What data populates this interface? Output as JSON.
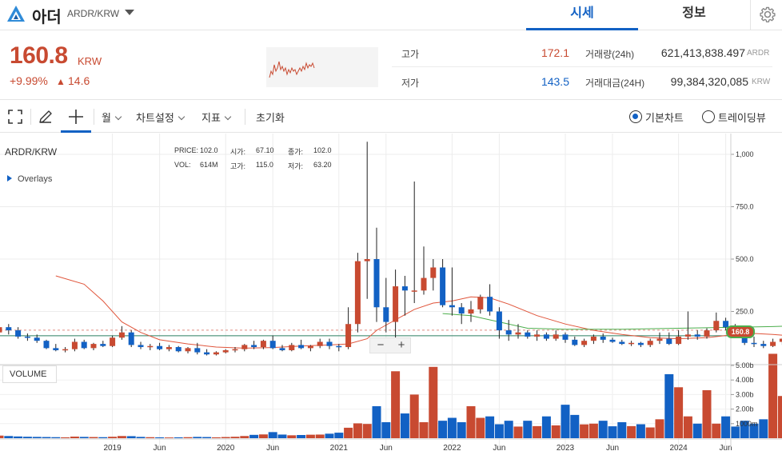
{
  "header": {
    "coin_name": "아더",
    "pair": "ARDR/KRW",
    "tabs": [
      {
        "label": "시세",
        "active": true
      },
      {
        "label": "정보",
        "active": false
      }
    ]
  },
  "summary": {
    "price": "160.8",
    "unit": "KRW",
    "change_rate": "+9.99%",
    "change_arrow": "▲",
    "change_amount": "14.6",
    "high_label": "고가",
    "high_value": "172.1",
    "low_label": "저가",
    "low_value": "143.5",
    "volume_label": "거래량(24h)",
    "volume_value": "621,413,838.497",
    "volume_unit": "ARDR",
    "amount_label": "거래대금(24H)",
    "amount_value": "99,384,320,085",
    "amount_unit": "KRW",
    "up_color": "#c84a31",
    "down_color": "#1261c4"
  },
  "toolbar": {
    "period": "월",
    "chart_settings": "차트설정",
    "indicators": "지표",
    "reset": "초기화",
    "basic_chart": "기본차트",
    "tradingview": "트레이딩뷰",
    "selected_chart": "기본차트"
  },
  "chart": {
    "symbol": "ARDR/KRW",
    "overlays": "Overlays",
    "info": {
      "price_label": "PRICE:",
      "price": "102.0",
      "open_label": "시가:",
      "open": "67.10",
      "close_label": "종가:",
      "close": "102.0",
      "vol_label": "VOL:",
      "vol": "614M",
      "high_label": "고가:",
      "high": "115.0",
      "low_label": "저가:",
      "low": "63.20"
    },
    "volume_button": "VOLUME",
    "zoom_minus": "−",
    "zoom_plus": "+",
    "last_price_tag": "160.8"
  },
  "chart_data": {
    "type": "candlestick",
    "period": "월",
    "price_axis_ticks": [
      "1,000",
      "750.0",
      "500.0",
      "250.0"
    ],
    "price_ticks_values": [
      1000,
      750,
      500,
      250
    ],
    "volume_axis_ticks": [
      "5.00b",
      "4.00b",
      "3.00b",
      "2.00b",
      "1000m"
    ],
    "volume_ticks_values": [
      5000,
      4000,
      3000,
      2000,
      1000
    ],
    "x_axis_labels": [
      "2019",
      "Jun",
      "2020",
      "Jun",
      "2021",
      "Jun",
      "2022",
      "Jun",
      "2023",
      "Jun",
      "2024",
      "Jun"
    ],
    "x_axis_label_months": [
      12,
      17,
      24,
      29,
      36,
      41,
      48,
      53,
      60,
      65,
      72,
      77
    ],
    "y_max_visible": 1000,
    "y_min_visible": 0,
    "moving_average_colors": [
      "#e0553b",
      "#4cae4c"
    ],
    "candles": [
      {
        "m": 0,
        "o": 150,
        "h": 320,
        "l": 130,
        "c": 175
      },
      {
        "m": 1,
        "o": 175,
        "h": 190,
        "l": 140,
        "c": 160
      },
      {
        "m": 2,
        "o": 160,
        "h": 175,
        "l": 120,
        "c": 130
      },
      {
        "m": 3,
        "o": 130,
        "h": 145,
        "l": 110,
        "c": 125
      },
      {
        "m": 4,
        "o": 125,
        "h": 140,
        "l": 100,
        "c": 110
      },
      {
        "m": 5,
        "o": 110,
        "h": 115,
        "l": 70,
        "c": 75
      },
      {
        "m": 6,
        "o": 75,
        "h": 95,
        "l": 60,
        "c": 65
      },
      {
        "m": 7,
        "o": 65,
        "h": 80,
        "l": 55,
        "c": 70
      },
      {
        "m": 8,
        "o": 70,
        "h": 120,
        "l": 60,
        "c": 105
      },
      {
        "m": 9,
        "o": 105,
        "h": 115,
        "l": 70,
        "c": 75
      },
      {
        "m": 10,
        "o": 75,
        "h": 100,
        "l": 65,
        "c": 95
      },
      {
        "m": 11,
        "o": 95,
        "h": 110,
        "l": 80,
        "c": 85
      },
      {
        "m": 12,
        "o": 85,
        "h": 135,
        "l": 80,
        "c": 125
      },
      {
        "m": 13,
        "o": 125,
        "h": 180,
        "l": 115,
        "c": 150
      },
      {
        "m": 14,
        "o": 150,
        "h": 160,
        "l": 80,
        "c": 90
      },
      {
        "m": 15,
        "o": 90,
        "h": 105,
        "l": 70,
        "c": 80
      },
      {
        "m": 16,
        "o": 80,
        "h": 95,
        "l": 65,
        "c": 85
      },
      {
        "m": 17,
        "o": 85,
        "h": 100,
        "l": 65,
        "c": 70
      },
      {
        "m": 18,
        "o": 70,
        "h": 90,
        "l": 60,
        "c": 80
      },
      {
        "m": 19,
        "o": 80,
        "h": 85,
        "l": 55,
        "c": 60
      },
      {
        "m": 20,
        "o": 60,
        "h": 80,
        "l": 50,
        "c": 75
      },
      {
        "m": 21,
        "o": 75,
        "h": 100,
        "l": 45,
        "c": 55
      },
      {
        "m": 22,
        "o": 55,
        "h": 70,
        "l": 40,
        "c": 45
      },
      {
        "m": 23,
        "o": 45,
        "h": 60,
        "l": 40,
        "c": 55
      },
      {
        "m": 24,
        "o": 55,
        "h": 70,
        "l": 50,
        "c": 65
      },
      {
        "m": 25,
        "o": 65,
        "h": 80,
        "l": 55,
        "c": 70
      },
      {
        "m": 26,
        "o": 70,
        "h": 95,
        "l": 60,
        "c": 90
      },
      {
        "m": 27,
        "o": 90,
        "h": 110,
        "l": 70,
        "c": 80
      },
      {
        "m": 28,
        "o": 80,
        "h": 115,
        "l": 70,
        "c": 110
      },
      {
        "m": 29,
        "o": 110,
        "h": 135,
        "l": 70,
        "c": 75
      },
      {
        "m": 30,
        "o": 75,
        "h": 90,
        "l": 60,
        "c": 65
      },
      {
        "m": 31,
        "o": 65,
        "h": 100,
        "l": 60,
        "c": 90
      },
      {
        "m": 32,
        "o": 90,
        "h": 115,
        "l": 70,
        "c": 75
      },
      {
        "m": 33,
        "o": 75,
        "h": 90,
        "l": 60,
        "c": 85
      },
      {
        "m": 34,
        "o": 85,
        "h": 120,
        "l": 75,
        "c": 105
      },
      {
        "m": 35,
        "o": 105,
        "h": 120,
        "l": 70,
        "c": 85
      },
      {
        "m": 36,
        "o": 85,
        "h": 95,
        "l": 60,
        "c": 80
      },
      {
        "m": 37,
        "o": 80,
        "h": 270,
        "l": 70,
        "c": 190
      },
      {
        "m": 38,
        "o": 190,
        "h": 530,
        "l": 150,
        "c": 490
      },
      {
        "m": 39,
        "o": 490,
        "h": 1060,
        "l": 310,
        "c": 500
      },
      {
        "m": 40,
        "o": 500,
        "h": 650,
        "l": 200,
        "c": 270
      },
      {
        "m": 41,
        "o": 270,
        "h": 410,
        "l": 150,
        "c": 200
      },
      {
        "m": 42,
        "o": 200,
        "h": 450,
        "l": 120,
        "c": 370
      },
      {
        "m": 43,
        "o": 370,
        "h": 420,
        "l": 230,
        "c": 350
      },
      {
        "m": 44,
        "o": 350,
        "h": 870,
        "l": 290,
        "c": 350
      },
      {
        "m": 45,
        "o": 350,
        "h": 560,
        "l": 330,
        "c": 410
      },
      {
        "m": 46,
        "o": 410,
        "h": 500,
        "l": 350,
        "c": 460
      },
      {
        "m": 47,
        "o": 460,
        "h": 500,
        "l": 270,
        "c": 280
      },
      {
        "m": 48,
        "o": 280,
        "h": 460,
        "l": 230,
        "c": 270
      },
      {
        "m": 49,
        "o": 270,
        "h": 290,
        "l": 190,
        "c": 240
      },
      {
        "m": 50,
        "o": 240,
        "h": 300,
        "l": 200,
        "c": 260
      },
      {
        "m": 51,
        "o": 260,
        "h": 330,
        "l": 240,
        "c": 320
      },
      {
        "m": 52,
        "o": 320,
        "h": 380,
        "l": 230,
        "c": 250
      },
      {
        "m": 53,
        "o": 250,
        "h": 270,
        "l": 120,
        "c": 160
      },
      {
        "m": 54,
        "o": 160,
        "h": 210,
        "l": 110,
        "c": 140
      },
      {
        "m": 55,
        "o": 140,
        "h": 190,
        "l": 120,
        "c": 150
      },
      {
        "m": 56,
        "o": 150,
        "h": 160,
        "l": 120,
        "c": 130
      },
      {
        "m": 57,
        "o": 130,
        "h": 160,
        "l": 110,
        "c": 140
      },
      {
        "m": 58,
        "o": 140,
        "h": 150,
        "l": 110,
        "c": 120
      },
      {
        "m": 59,
        "o": 120,
        "h": 160,
        "l": 110,
        "c": 140
      },
      {
        "m": 60,
        "o": 140,
        "h": 150,
        "l": 100,
        "c": 115
      },
      {
        "m": 61,
        "o": 115,
        "h": 130,
        "l": 85,
        "c": 90
      },
      {
        "m": 62,
        "o": 90,
        "h": 120,
        "l": 80,
        "c": 110
      },
      {
        "m": 63,
        "o": 110,
        "h": 140,
        "l": 95,
        "c": 130
      },
      {
        "m": 64,
        "o": 130,
        "h": 145,
        "l": 100,
        "c": 115
      },
      {
        "m": 65,
        "o": 115,
        "h": 125,
        "l": 100,
        "c": 105
      },
      {
        "m": 66,
        "o": 105,
        "h": 115,
        "l": 90,
        "c": 95
      },
      {
        "m": 67,
        "o": 95,
        "h": 110,
        "l": 85,
        "c": 100
      },
      {
        "m": 68,
        "o": 100,
        "h": 105,
        "l": 80,
        "c": 90
      },
      {
        "m": 69,
        "o": 90,
        "h": 120,
        "l": 80,
        "c": 110
      },
      {
        "m": 70,
        "o": 110,
        "h": 150,
        "l": 95,
        "c": 120
      },
      {
        "m": 71,
        "o": 120,
        "h": 150,
        "l": 90,
        "c": 95
      },
      {
        "m": 72,
        "o": 95,
        "h": 160,
        "l": 90,
        "c": 130
      },
      {
        "m": 73,
        "o": 130,
        "h": 250,
        "l": 115,
        "c": 140
      },
      {
        "m": 74,
        "o": 140,
        "h": 160,
        "l": 115,
        "c": 130
      },
      {
        "m": 75,
        "o": 130,
        "h": 170,
        "l": 120,
        "c": 160
      },
      {
        "m": 76,
        "o": 160,
        "h": 245,
        "l": 150,
        "c": 205
      },
      {
        "m": 77,
        "o": 205,
        "h": 220,
        "l": 160,
        "c": 175
      },
      {
        "m": 78,
        "o": 175,
        "h": 190,
        "l": 130,
        "c": 140
      },
      {
        "m": 79,
        "o": 140,
        "h": 155,
        "l": 90,
        "c": 100
      },
      {
        "m": 80,
        "o": 100,
        "h": 130,
        "l": 80,
        "c": 95
      },
      {
        "m": 81,
        "o": 95,
        "h": 110,
        "l": 75,
        "c": 85
      },
      {
        "m": 82,
        "o": 85,
        "h": 120,
        "l": 80,
        "c": 105
      },
      {
        "m": 83,
        "o": 105,
        "h": 125,
        "l": 90,
        "c": 120
      },
      {
        "m": 84,
        "o": 120,
        "h": 180,
        "l": 110,
        "c": 146
      },
      {
        "m": 85,
        "o": 146,
        "h": 172,
        "l": 143,
        "c": 161
      }
    ],
    "volume_values": [
      180,
      150,
      120,
      100,
      90,
      80,
      70,
      60,
      110,
      90,
      80,
      70,
      100,
      150,
      140,
      90,
      70,
      60,
      50,
      60,
      70,
      90,
      80,
      60,
      80,
      100,
      150,
      230,
      260,
      420,
      250,
      200,
      220,
      240,
      250,
      310,
      380,
      720,
      1020,
      980,
      2200,
      1100,
      4600,
      1700,
      3000,
      1100,
      4900,
      1200,
      1400,
      1100,
      2200,
      1400,
      1500,
      960,
      1200,
      800,
      1200,
      830,
      1500,
      880,
      2300,
      1600,
      950,
      1000,
      1200,
      820,
      1100,
      830,
      960,
      740,
      1300,
      4400,
      3500,
      1500,
      1000,
      3300,
      1000,
      1500,
      800,
      1200,
      1000,
      1300,
      5800,
      2900,
      2700,
      3100
    ],
    "ma_short": [
      [
        6,
        420
      ],
      [
        9,
        380
      ],
      [
        11,
        300
      ],
      [
        13,
        200
      ],
      [
        15,
        150
      ],
      [
        17,
        115
      ],
      [
        20,
        95
      ],
      [
        23,
        80
      ],
      [
        26,
        75
      ],
      [
        29,
        78
      ],
      [
        32,
        85
      ],
      [
        35,
        90
      ],
      [
        37,
        95
      ],
      [
        39,
        120
      ],
      [
        40,
        160
      ],
      [
        42,
        210
      ],
      [
        44,
        260
      ],
      [
        46,
        290
      ],
      [
        48,
        300
      ],
      [
        50,
        320
      ],
      [
        52,
        315
      ],
      [
        54,
        285
      ],
      [
        57,
        230
      ],
      [
        60,
        190
      ],
      [
        63,
        160
      ],
      [
        66,
        140
      ],
      [
        69,
        125
      ],
      [
        72,
        120
      ],
      [
        75,
        125
      ],
      [
        78,
        140
      ],
      [
        80,
        145
      ],
      [
        82,
        140
      ],
      [
        85,
        130
      ]
    ],
    "ma_long": [
      [
        47,
        240
      ],
      [
        50,
        230
      ],
      [
        53,
        200
      ],
      [
        56,
        170
      ],
      [
        60,
        165
      ],
      [
        66,
        165
      ],
      [
        72,
        170
      ],
      [
        78,
        175
      ],
      [
        82,
        178
      ],
      [
        85,
        182
      ]
    ],
    "last_price_line": 160.8,
    "reference_line": 134.0
  }
}
